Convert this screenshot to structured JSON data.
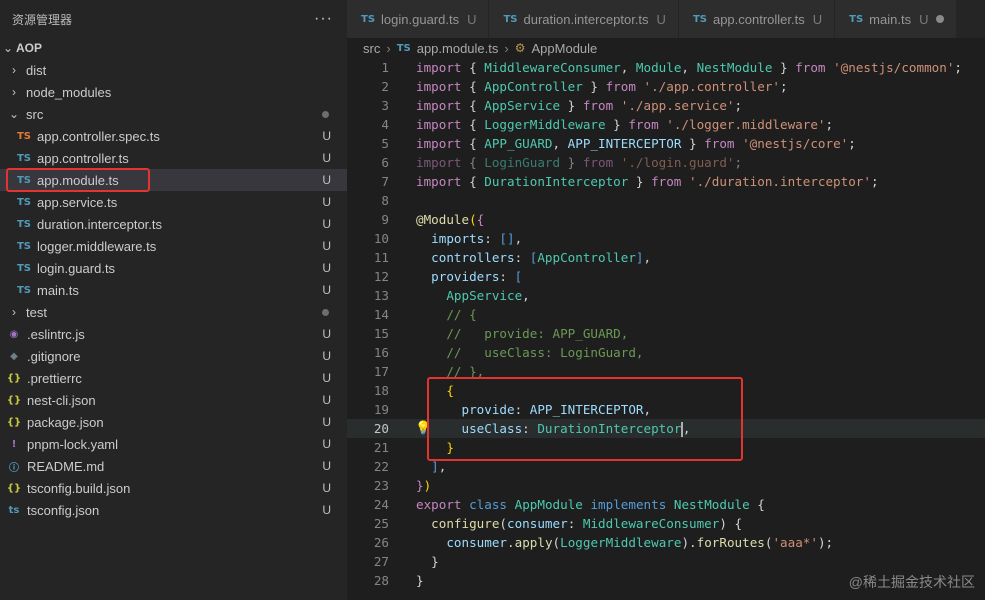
{
  "explorer": {
    "title": "资源管理器",
    "more": "···",
    "root": "AOP",
    "items": [
      {
        "label": "dist",
        "kind": "folder",
        "open": false,
        "depth": 1,
        "status": ""
      },
      {
        "label": "node_modules",
        "kind": "folder",
        "open": false,
        "depth": 1,
        "status": ""
      },
      {
        "label": "src",
        "kind": "folder",
        "open": true,
        "depth": 1,
        "status": "dot"
      },
      {
        "label": "app.controller.spec.ts",
        "kind": "ts-orange",
        "depth": 2,
        "status": "U"
      },
      {
        "label": "app.controller.ts",
        "kind": "ts",
        "depth": 2,
        "status": "U"
      },
      {
        "label": "app.module.ts",
        "kind": "ts",
        "depth": 2,
        "status": "U",
        "selected": true
      },
      {
        "label": "app.service.ts",
        "kind": "ts",
        "depth": 2,
        "status": "U"
      },
      {
        "label": "duration.interceptor.ts",
        "kind": "ts",
        "depth": 2,
        "status": "U"
      },
      {
        "label": "logger.middleware.ts",
        "kind": "ts",
        "depth": 2,
        "status": "U"
      },
      {
        "label": "login.guard.ts",
        "kind": "ts",
        "depth": 2,
        "status": "U"
      },
      {
        "label": "main.ts",
        "kind": "ts",
        "depth": 2,
        "status": "U"
      },
      {
        "label": "test",
        "kind": "folder",
        "open": false,
        "depth": 1,
        "status": "dot"
      },
      {
        "label": ".eslintrc.js",
        "kind": "eslint",
        "depth": 1,
        "status": "U"
      },
      {
        "label": ".gitignore",
        "kind": "git",
        "depth": 1,
        "status": "U"
      },
      {
        "label": ".prettierrc",
        "kind": "json",
        "depth": 1,
        "status": "U"
      },
      {
        "label": "nest-cli.json",
        "kind": "json",
        "depth": 1,
        "status": "U"
      },
      {
        "label": "package.json",
        "kind": "json",
        "depth": 1,
        "status": "U"
      },
      {
        "label": "pnpm-lock.yaml",
        "kind": "yaml",
        "depth": 1,
        "status": "U"
      },
      {
        "label": "README.md",
        "kind": "info",
        "depth": 1,
        "status": "U"
      },
      {
        "label": "tsconfig.build.json",
        "kind": "json",
        "depth": 1,
        "status": "U"
      },
      {
        "label": "tsconfig.json",
        "kind": "tsconfig",
        "depth": 1,
        "status": "U"
      }
    ]
  },
  "tabs": [
    {
      "label": "login.guard.ts",
      "status": "U"
    },
    {
      "label": "duration.interceptor.ts",
      "status": "U"
    },
    {
      "label": "app.controller.ts",
      "status": "U"
    },
    {
      "label": "main.ts",
      "status": "U"
    }
  ],
  "breadcrumb": {
    "folder": "src",
    "file": "app.module.ts",
    "symbol": "AppModule",
    "ts_badge": "TS",
    "chev": "›",
    "symbol_icon": "⚙"
  },
  "editor": {
    "current_line": 20,
    "lines": [
      [
        [
          "k",
          "import"
        ],
        [
          "p",
          " { "
        ],
        [
          "t",
          "MiddlewareConsumer"
        ],
        [
          "p",
          ", "
        ],
        [
          "t",
          "Module"
        ],
        [
          "p",
          ", "
        ],
        [
          "t",
          "NestModule"
        ],
        [
          "p",
          " } "
        ],
        [
          "k",
          "from"
        ],
        [
          "p",
          " "
        ],
        [
          "s",
          "'@nestjs/common'"
        ],
        [
          "p",
          ";"
        ]
      ],
      [
        [
          "k",
          "import"
        ],
        [
          "p",
          " { "
        ],
        [
          "t",
          "AppController"
        ],
        [
          "p",
          " } "
        ],
        [
          "k",
          "from"
        ],
        [
          "p",
          " "
        ],
        [
          "s",
          "'./app.controller'"
        ],
        [
          "p",
          ";"
        ]
      ],
      [
        [
          "k",
          "import"
        ],
        [
          "p",
          " { "
        ],
        [
          "t",
          "AppService"
        ],
        [
          "p",
          " } "
        ],
        [
          "k",
          "from"
        ],
        [
          "p",
          " "
        ],
        [
          "s",
          "'./app.service'"
        ],
        [
          "p",
          ";"
        ]
      ],
      [
        [
          "k",
          "import"
        ],
        [
          "p",
          " { "
        ],
        [
          "t",
          "LoggerMiddleware"
        ],
        [
          "p",
          " } "
        ],
        [
          "k",
          "from"
        ],
        [
          "p",
          " "
        ],
        [
          "s",
          "'./logger.middleware'"
        ],
        [
          "p",
          ";"
        ]
      ],
      [
        [
          "k",
          "import"
        ],
        [
          "p",
          " { "
        ],
        [
          "t",
          "APP_GUARD"
        ],
        [
          "p",
          ", "
        ],
        [
          "v",
          "APP_INTERCEPTOR"
        ],
        [
          "p",
          " } "
        ],
        [
          "k",
          "from"
        ],
        [
          "p",
          " "
        ],
        [
          "s",
          "'@nestjs/core'"
        ],
        [
          "p",
          ";"
        ]
      ],
      [
        [
          "dim",
          ""
        ],
        [
          "k",
          "import"
        ],
        [
          "p",
          " { "
        ],
        [
          "t",
          "LoginGuard"
        ],
        [
          "p",
          " } "
        ],
        [
          "k",
          "from"
        ],
        [
          "p",
          " "
        ],
        [
          "s",
          "'./login.guard'"
        ],
        [
          "p",
          ";"
        ]
      ],
      [
        [
          "k",
          "import"
        ],
        [
          "p",
          " { "
        ],
        [
          "t",
          "DurationInterceptor"
        ],
        [
          "p",
          " } "
        ],
        [
          "k",
          "from"
        ],
        [
          "p",
          " "
        ],
        [
          "s",
          "'./duration.interceptor'"
        ],
        [
          "p",
          ";"
        ]
      ],
      [],
      [
        [
          "f",
          "@Module"
        ],
        [
          "br",
          "("
        ],
        [
          "k",
          "{"
        ]
      ],
      [
        [
          "p",
          "  "
        ],
        [
          "v",
          "imports"
        ],
        [
          "p",
          ": "
        ],
        [
          "b",
          "[]"
        ],
        [
          "p",
          ","
        ]
      ],
      [
        [
          "p",
          "  "
        ],
        [
          "v",
          "controllers"
        ],
        [
          "p",
          ": "
        ],
        [
          "b",
          "["
        ],
        [
          "t",
          "AppController"
        ],
        [
          "b",
          "]"
        ],
        [
          "p",
          ","
        ]
      ],
      [
        [
          "p",
          "  "
        ],
        [
          "v",
          "providers"
        ],
        [
          "p",
          ": "
        ],
        [
          "b",
          "["
        ]
      ],
      [
        [
          "p",
          "    "
        ],
        [
          "t",
          "AppService"
        ],
        [
          "p",
          ","
        ]
      ],
      [
        [
          "p",
          "    "
        ],
        [
          "c",
          "// {"
        ]
      ],
      [
        [
          "p",
          "    "
        ],
        [
          "c",
          "//   provide: APP_GUARD,"
        ]
      ],
      [
        [
          "p",
          "    "
        ],
        [
          "c",
          "//   useClass: LoginGuard,"
        ]
      ],
      [
        [
          "p",
          "    "
        ],
        [
          "c",
          "// },"
        ]
      ],
      [
        [
          "p",
          "    "
        ],
        [
          "br",
          "{"
        ]
      ],
      [
        [
          "p",
          "      "
        ],
        [
          "v",
          "provide"
        ],
        [
          "p",
          ": "
        ],
        [
          "v",
          "APP_INTERCEPTOR"
        ],
        [
          "p",
          ","
        ]
      ],
      [
        [
          "p",
          "      "
        ],
        [
          "v",
          "useClass"
        ],
        [
          "p",
          ": "
        ],
        [
          "t",
          "DurationInterceptor"
        ],
        [
          "cur",
          ""
        ],
        [
          "p",
          ","
        ]
      ],
      [
        [
          "p",
          "    "
        ],
        [
          "br",
          "}"
        ]
      ],
      [
        [
          "p",
          "  "
        ],
        [
          "b",
          "]"
        ],
        [
          "p",
          ","
        ]
      ],
      [
        [
          "k",
          "}"
        ],
        [
          "br",
          ")"
        ]
      ],
      [
        [
          "k",
          "export"
        ],
        [
          "p",
          " "
        ],
        [
          "b",
          "class"
        ],
        [
          "p",
          " "
        ],
        [
          "t",
          "AppModule"
        ],
        [
          "p",
          " "
        ],
        [
          "b",
          "implements"
        ],
        [
          "p",
          " "
        ],
        [
          "t",
          "NestModule"
        ],
        [
          "p",
          " {"
        ]
      ],
      [
        [
          "p",
          "  "
        ],
        [
          "f",
          "configure"
        ],
        [
          "p",
          "("
        ],
        [
          "v",
          "consumer"
        ],
        [
          "p",
          ": "
        ],
        [
          "t",
          "MiddlewareConsumer"
        ],
        [
          "p",
          ") {"
        ]
      ],
      [
        [
          "p",
          "    "
        ],
        [
          "v",
          "consumer"
        ],
        [
          "p",
          "."
        ],
        [
          "f",
          "apply"
        ],
        [
          "p",
          "("
        ],
        [
          "t",
          "LoggerMiddleware"
        ],
        [
          "p",
          ")."
        ],
        [
          "f",
          "forRoutes"
        ],
        [
          "p",
          "("
        ],
        [
          "s",
          "'aaa*'"
        ],
        [
          "p",
          ");"
        ]
      ],
      [
        [
          "p",
          "  }"
        ]
      ],
      [
        [
          "p",
          "}"
        ]
      ]
    ]
  },
  "watermark": "@稀土掘金技术社区",
  "colors": {
    "highlight": "#e3342f",
    "ts": "#519aba",
    "ts_orange": "#e37933",
    "json": "#cbcb41"
  }
}
